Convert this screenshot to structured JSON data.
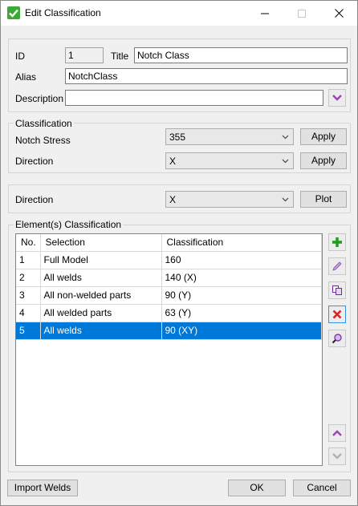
{
  "window": {
    "title": "Edit Classification"
  },
  "general": {
    "id_label": "ID",
    "id_value": "1",
    "title_label": "Title",
    "title_value": "Notch Class",
    "alias_label": "Alias",
    "alias_value": "NotchClass",
    "description_label": "Description",
    "description_value": ""
  },
  "classification": {
    "group_label": "Classification",
    "notch_stress_label": "Notch Stress",
    "notch_stress_value": "355",
    "direction_label": "Direction",
    "direction_value": "X",
    "apply_label": "Apply"
  },
  "plot": {
    "direction_label": "Direction",
    "direction_value": "X",
    "plot_label": "Plot"
  },
  "elements": {
    "group_label": "Element(s) Classification",
    "columns": [
      "No.",
      "Selection",
      "Classification"
    ],
    "rows": [
      {
        "no": "1",
        "selection": "Full Model",
        "classification": "160"
      },
      {
        "no": "2",
        "selection": "All welds",
        "classification": "140 (X)"
      },
      {
        "no": "3",
        "selection": "All non-welded parts",
        "classification": "90 (Y)"
      },
      {
        "no": "4",
        "selection": "All welded parts",
        "classification": "63 (Y)"
      },
      {
        "no": "5",
        "selection": "All welds",
        "classification": "90 (XY)"
      }
    ],
    "selected_row": 5
  },
  "footer": {
    "import_label": "Import Welds",
    "ok_label": "OK",
    "cancel_label": "Cancel"
  },
  "colors": {
    "selection": "#0078d7",
    "check_green": "#3aa935",
    "add_green": "#1e9e1e",
    "delete_red": "#e02020",
    "accent_purple": "#a040c0"
  }
}
